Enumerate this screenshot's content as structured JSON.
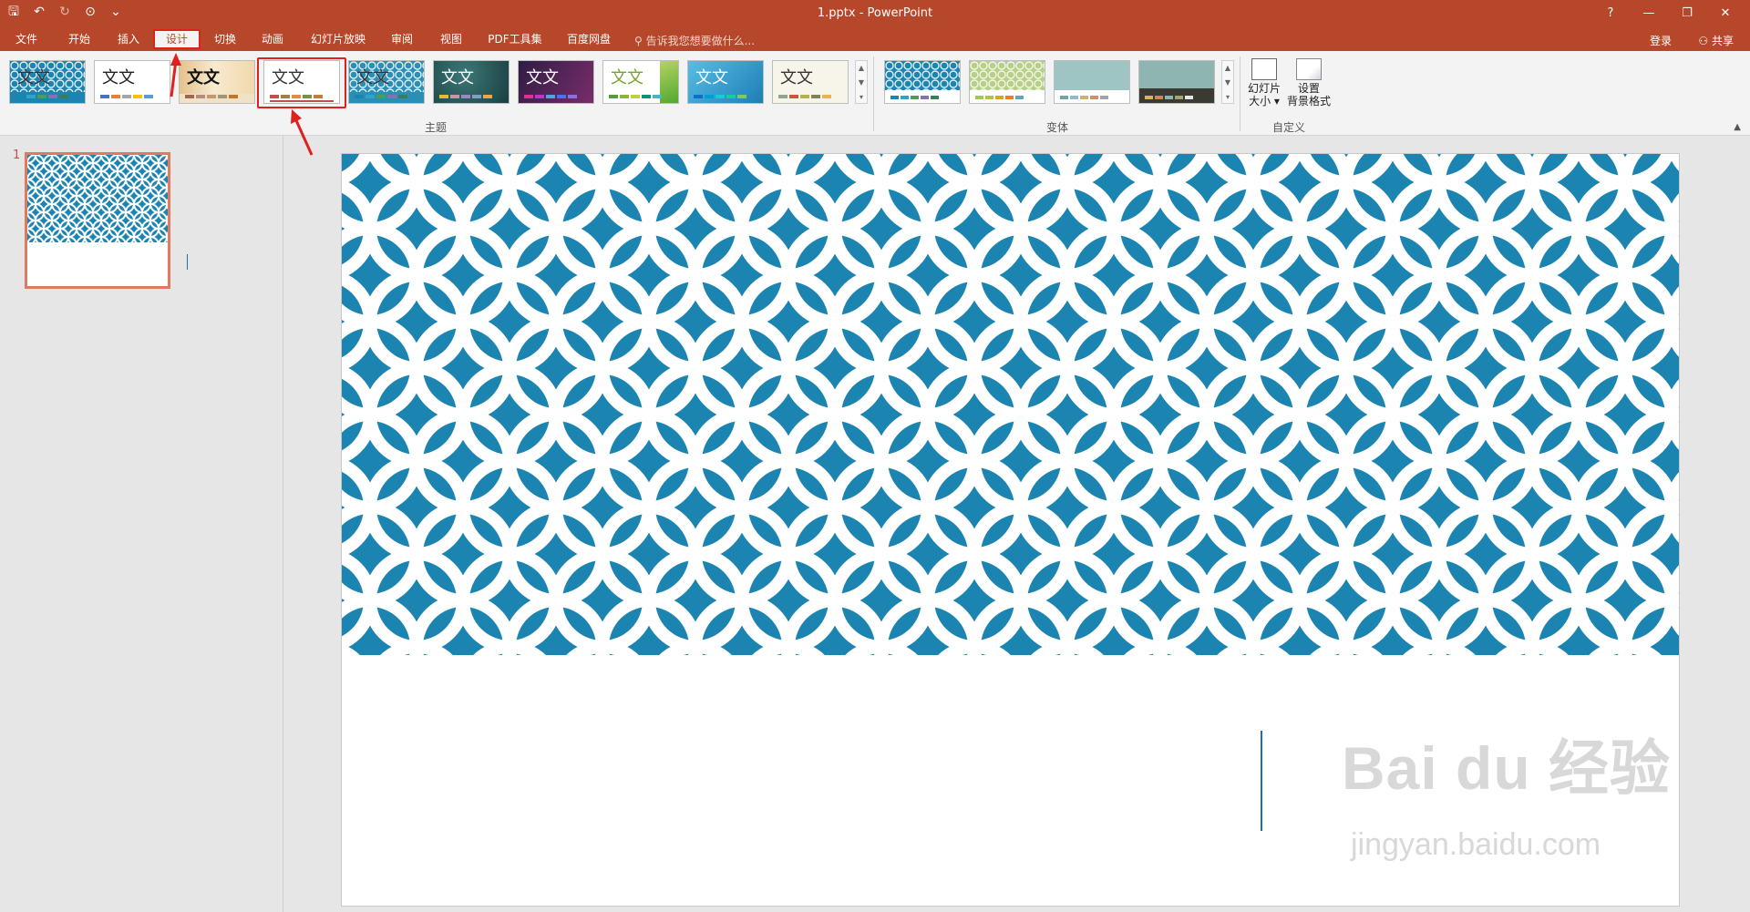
{
  "window": {
    "title": "1.pptx - PowerPoint",
    "controls": [
      "?",
      "—",
      "❐",
      "✕"
    ]
  },
  "qat": {
    "save": "🖫",
    "undo": "↶",
    "redo": "↻",
    "custom": "⊙",
    "more": "⌄"
  },
  "tabs": [
    {
      "label": "文件"
    },
    {
      "label": "开始"
    },
    {
      "label": "插入"
    },
    {
      "label": "设计"
    },
    {
      "label": "切换"
    },
    {
      "label": "动画"
    },
    {
      "label": "幻灯片放映"
    },
    {
      "label": "审阅"
    },
    {
      "label": "视图"
    },
    {
      "label": "PDF工具集"
    },
    {
      "label": "百度网盘"
    }
  ],
  "tell_me": "告诉我您想要做什么...",
  "login": "登录",
  "share": "共享",
  "ribbon": {
    "themes_group": "主题",
    "variants_group": "变体",
    "customize_group": "自定义",
    "theme_text": "文文",
    "slide_size_label1": "幻灯片",
    "slide_size_label2": "大小",
    "bg_format_label1": "设置",
    "bg_format_label2": "背景格式"
  },
  "slides_pane": {
    "slide_number": "1"
  },
  "watermark": {
    "brand": "Bai du 经验",
    "url": "jingyan.baidu.com"
  },
  "colors": {
    "accent": "#b7472a",
    "slide_pattern": "#1b84b0",
    "highlight": "#e0201c"
  }
}
